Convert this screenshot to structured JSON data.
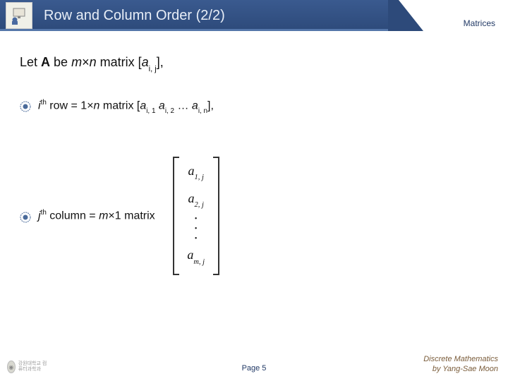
{
  "header": {
    "title": "Row and Column Order (2/2)",
    "section": "Matrices"
  },
  "body": {
    "intro_prefix": "Let ",
    "intro_A": "A",
    "intro_be": " be ",
    "intro_m": "m",
    "intro_times": "×",
    "intro_n": "n",
    "intro_matrix": " matrix [",
    "intro_a": "a",
    "intro_sub": "i, j",
    "intro_close": "],",
    "row_i": "i",
    "row_th": "th",
    "row_text1": " row = 1",
    "row_times": "×",
    "row_n": "n",
    "row_text2": " matrix [",
    "row_a1": "a",
    "row_s1": "i, 1",
    "row_sp": "  ",
    "row_a2": "a",
    "row_s2": "i, 2",
    "row_dots": " … ",
    "row_a3": "a",
    "row_s3": "i, n",
    "row_close": "],",
    "col_j": "j",
    "col_th": "th",
    "col_text1": " column = ",
    "col_m": "m",
    "col_times": "×",
    "col_text2": "1 matrix",
    "matrix": {
      "r1_a": "a",
      "r1_s": "1, j",
      "r2_a": "a",
      "r2_s": "2, j",
      "rm_a": "a",
      "rm_s": "m, j"
    }
  },
  "footer": {
    "page": "Page 5",
    "credit1": "Discrete Mathematics",
    "credit2": "by Yang-Sae Moon",
    "logo_text": "강원대학교\n컴퓨터과학과"
  }
}
